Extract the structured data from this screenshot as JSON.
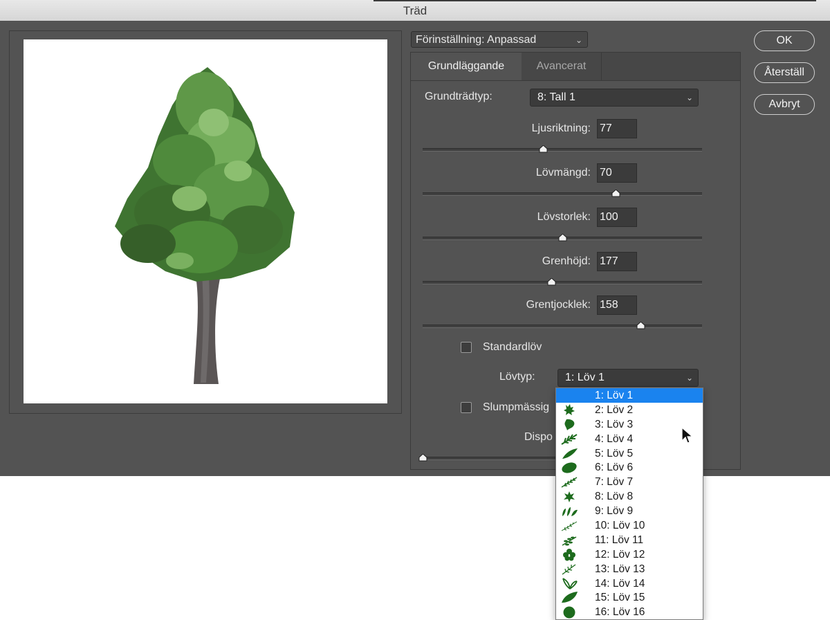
{
  "window": {
    "title": "Träd"
  },
  "preset": {
    "label": "Förinställning: Anpassad"
  },
  "tabs": {
    "basic": "Grundläggande",
    "advanced": "Avancerat"
  },
  "base_tree": {
    "label": "Grundträdtyp:",
    "value": "8: Tall 1"
  },
  "sliders": [
    {
      "label": "Ljusriktning:",
      "value": "77",
      "level": 0.43
    },
    {
      "label": "Lövmängd:",
      "value": "70",
      "level": 0.69
    },
    {
      "label": "Lövstorlek:",
      "value": "100",
      "level": 0.5
    },
    {
      "label": "Grenhöjd:",
      "value": "177",
      "level": 0.46
    },
    {
      "label": "Grentjocklek:",
      "value": "158",
      "level": 0.78
    }
  ],
  "default_leaves": {
    "label": "Standardlöv",
    "checked": false
  },
  "leaf_type": {
    "label": "Lövtyp:",
    "value": "1: Löv 1"
  },
  "randomize": {
    "label": "Slumpmässig",
    "checked": false
  },
  "disposition": {
    "label": "Dispo",
    "level": 0.0
  },
  "buttons": {
    "ok": "OK",
    "reset": "Återställ",
    "cancel": "Avbryt"
  },
  "leaf_options": [
    {
      "label": "1: Löv 1",
      "selected": true,
      "icon": "none"
    },
    {
      "label": "2: Löv 2",
      "icon": "maple-leaf-icon"
    },
    {
      "label": "3: Löv 3",
      "icon": "ginkgo-leaf-icon"
    },
    {
      "label": "4: Löv 4",
      "icon": "fern-leaf-icon"
    },
    {
      "label": "5: Löv 5",
      "icon": "long-leaf-icon"
    },
    {
      "label": "6: Löv 6",
      "icon": "oval-leaf-icon"
    },
    {
      "label": "7: Löv 7",
      "icon": "feather-leaf-icon"
    },
    {
      "label": "8: Löv 8",
      "icon": "lobed-leaf-icon"
    },
    {
      "label": "9: Löv 9",
      "icon": "leaf-cluster-icon"
    },
    {
      "label": "10: Löv 10",
      "icon": "thin-branch-leaf-icon"
    },
    {
      "label": "11: Löv 11",
      "icon": "sprig-leaf-icon"
    },
    {
      "label": "12: Löv 12",
      "icon": "clover-leaf-icon"
    },
    {
      "label": "13: Löv 13",
      "icon": "twig-leaf-icon"
    },
    {
      "label": "14: Löv 14",
      "icon": "split-leaf-icon"
    },
    {
      "label": "15: Löv 15",
      "icon": "broad-leaf-icon"
    },
    {
      "label": "16: Löv 16",
      "icon": "round-leaf-icon"
    }
  ],
  "colors": {
    "dialog_bg": "#535353",
    "accent": "#1a83ef",
    "leaf_green": "#1d6b1d"
  }
}
